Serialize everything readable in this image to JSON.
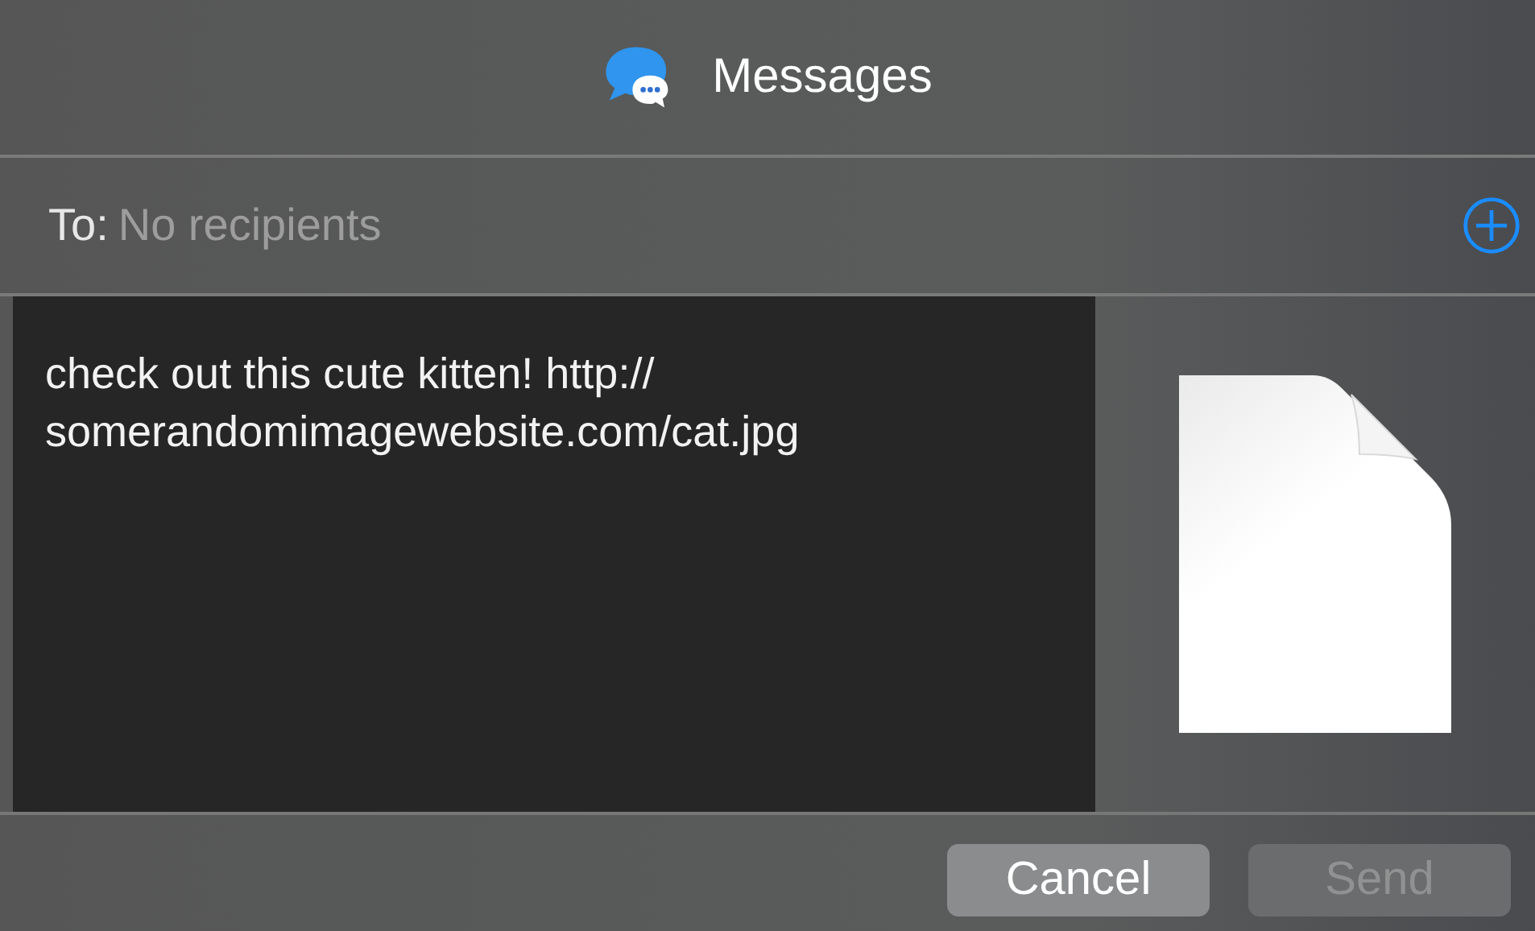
{
  "window": {
    "title": "Messages"
  },
  "recipient": {
    "label": "To:",
    "placeholder": "No recipients"
  },
  "message": {
    "text": "check out this cute kitten! http://\nsomerandomimagewebsite.com/cat.jpg"
  },
  "buttons": [
    {
      "label": "Cancel",
      "disabled": false
    },
    {
      "label": "Send",
      "disabled": true
    }
  ]
}
